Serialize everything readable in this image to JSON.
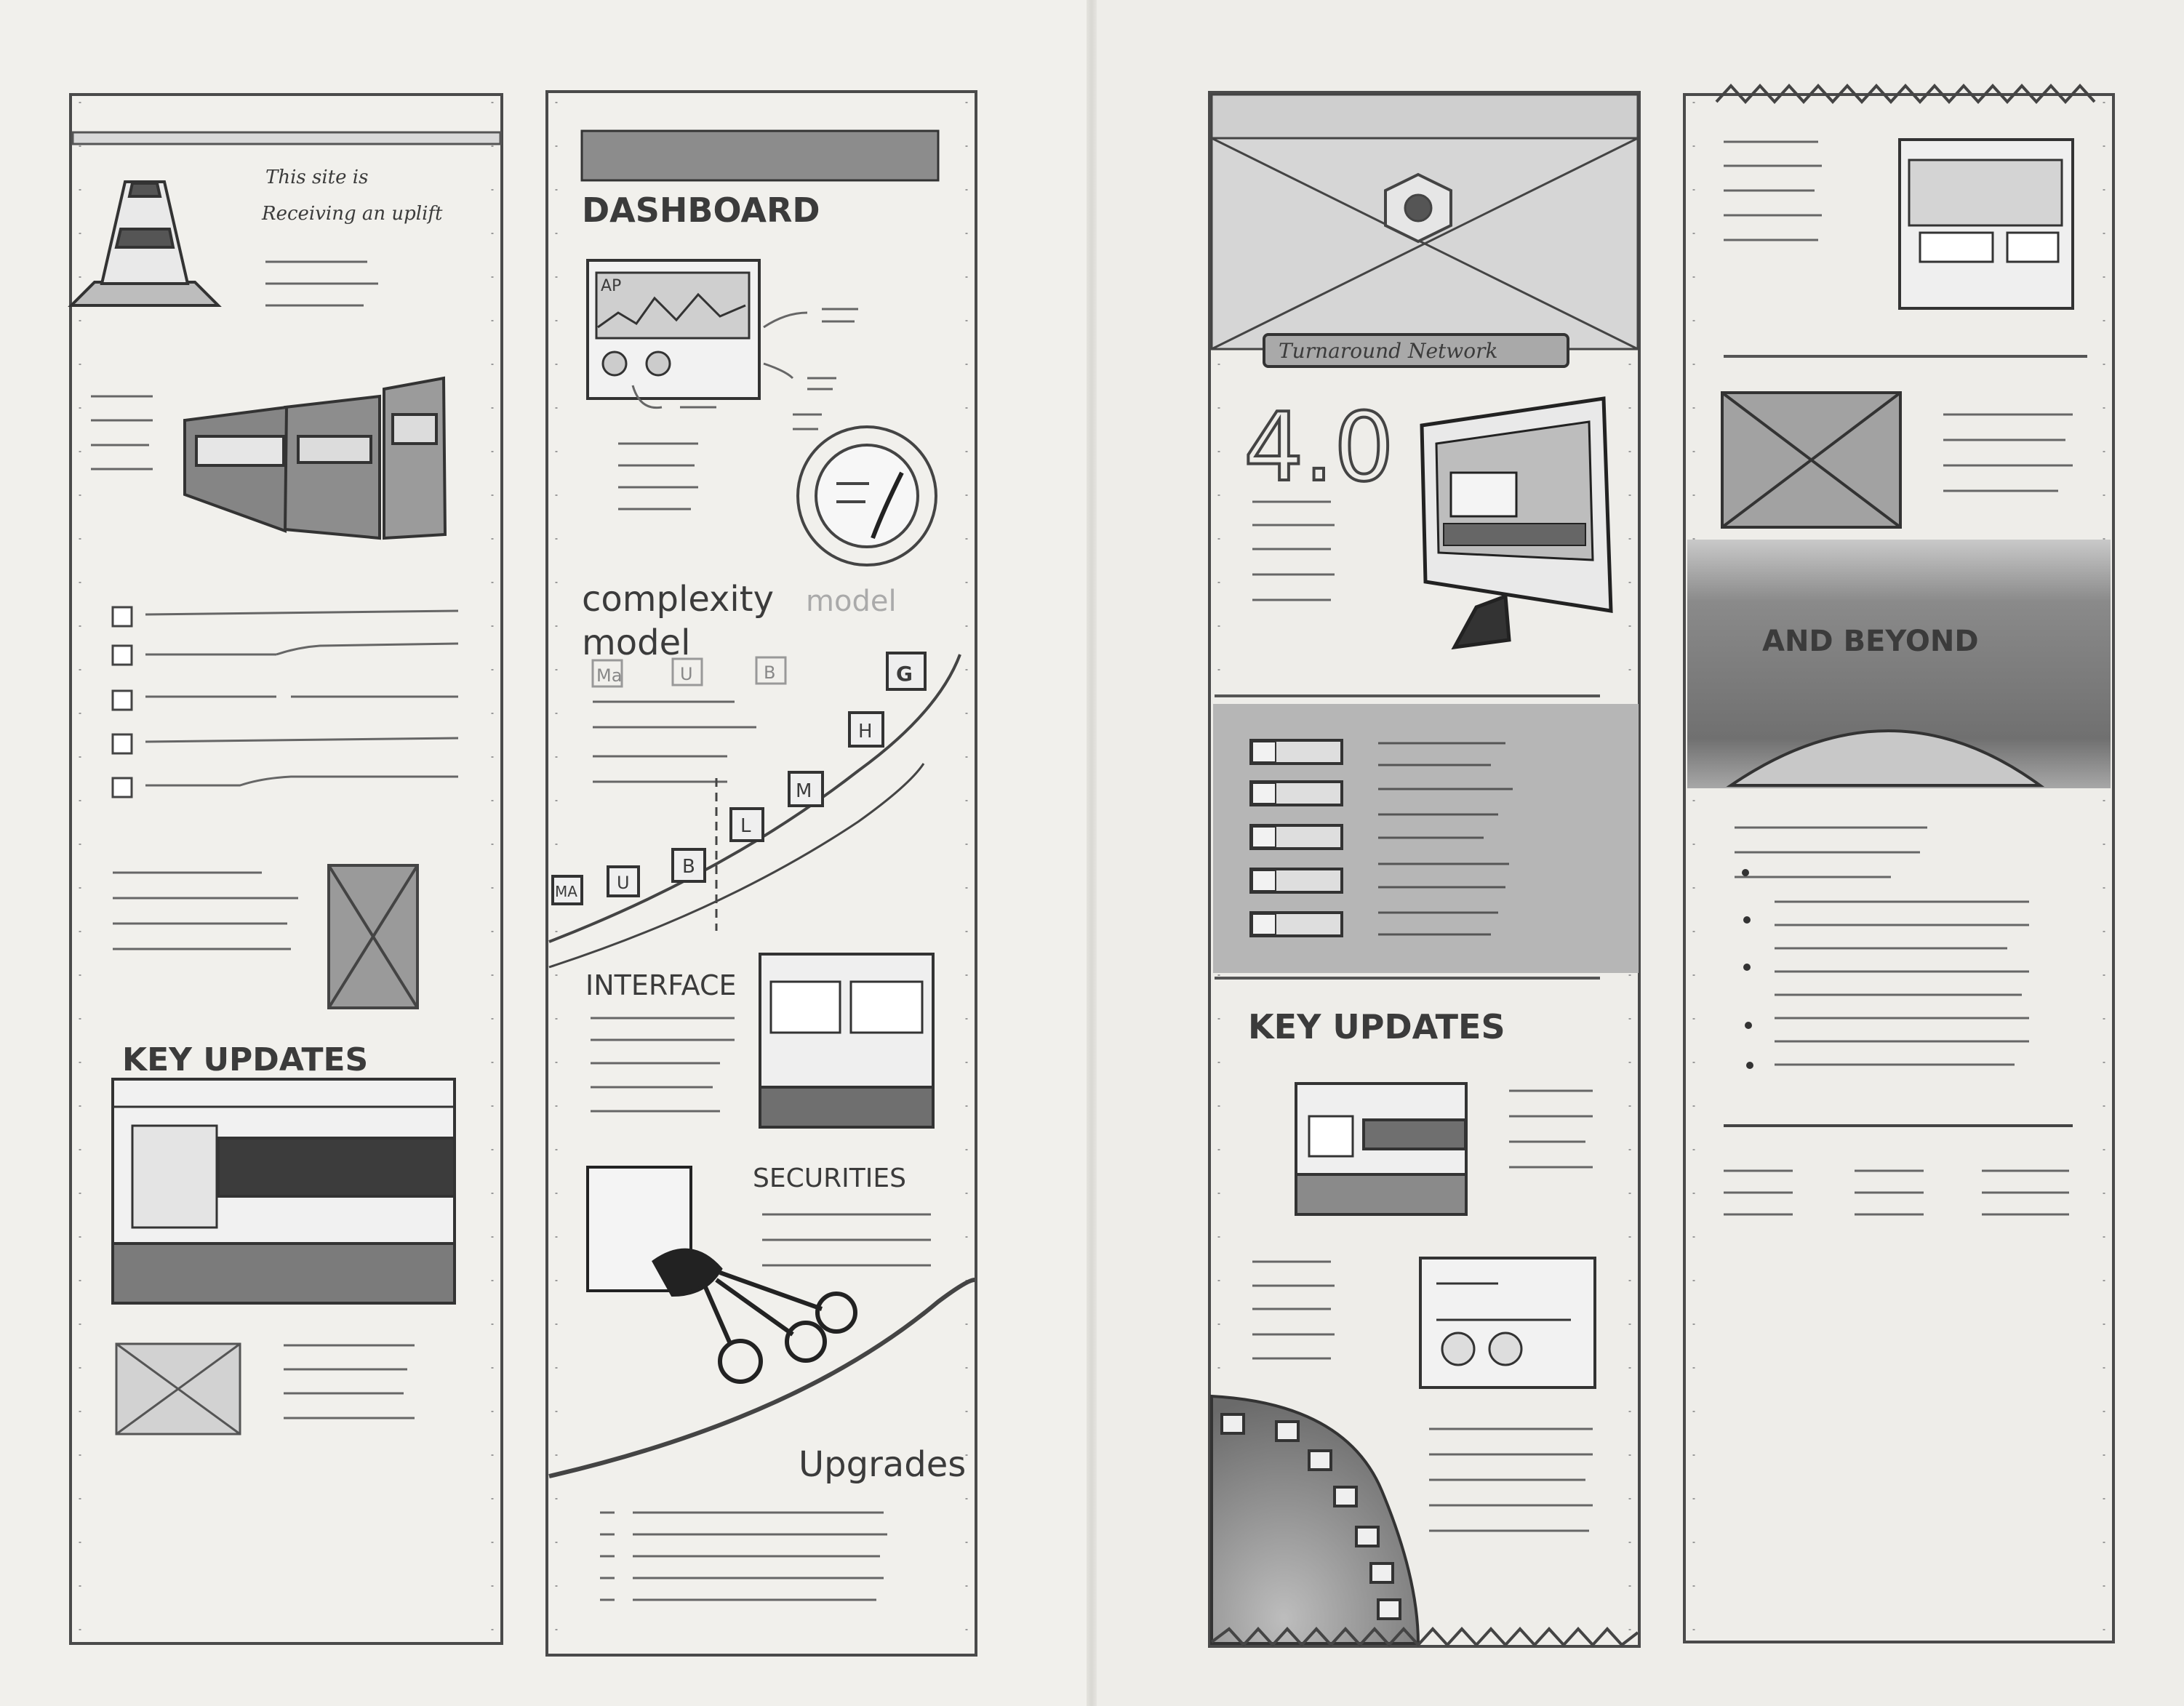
{
  "col1": {
    "hero_note_line1": "This site is",
    "hero_note_line2": "Receiving an uplift",
    "section_title": "KEY UPDATES"
  },
  "col2": {
    "dashboard_title": "DASHBOARD",
    "dashboard_chart_label": "AP",
    "complexity_title_line1": "complexity",
    "complexity_title_line2": "model",
    "complexity_ghost": "model",
    "blocks_top": [
      "Ma",
      "U",
      "B",
      "G"
    ],
    "blocks_curve": [
      "MA",
      "U",
      "B",
      "L",
      "M",
      "H"
    ],
    "interface_title": "INTERFACE",
    "securities_title": "SECURITIES",
    "upgrades_title": "Upgrades"
  },
  "col3": {
    "banner_label": "Turnaround Network",
    "version_number": "4.0",
    "section_title": "KEY UPDATES"
  },
  "col4": {
    "band_title": "AND BEYOND"
  }
}
